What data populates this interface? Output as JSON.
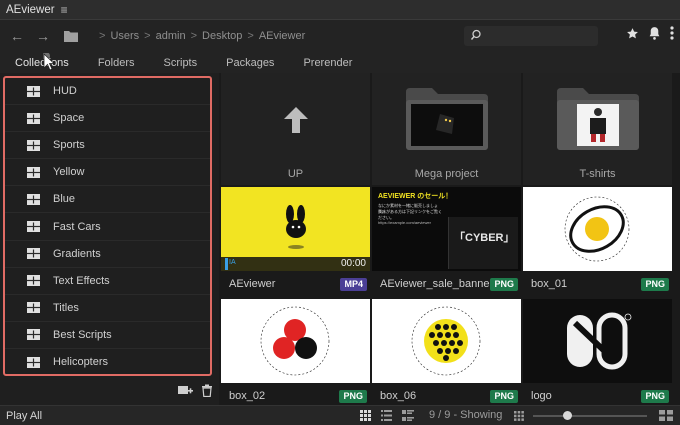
{
  "app": {
    "title": "AEviewer"
  },
  "breadcrumb": {
    "sep": ">",
    "items": [
      "Users",
      "admin",
      "Desktop",
      "AEviewer"
    ]
  },
  "search": {
    "placeholder": ""
  },
  "tabs": [
    "Collections",
    "Folders",
    "Scripts",
    "Packages",
    "Prerender"
  ],
  "active_tab": "Collections",
  "collections": [
    "HUD",
    "Space",
    "Sports",
    "Yellow",
    "Blue",
    "Fast Cars",
    "Gradients",
    "Text Effects",
    "Titles",
    "Best Scripts",
    "Helicopters"
  ],
  "grid": {
    "folders": [
      {
        "name": "UP",
        "icon": "up-arrow-icon"
      },
      {
        "name": "Mega project",
        "icon": "folder-icon"
      },
      {
        "name": "T-shirts",
        "icon": "folder-icon"
      }
    ],
    "files": [
      {
        "name": "AEviewer",
        "type": "MP4",
        "duration": "00:00",
        "marker": "IA"
      },
      {
        "name": "AEviewer_sale_banner",
        "type": "PNG"
      },
      {
        "name": "box_01",
        "type": "PNG"
      },
      {
        "name": "box_02",
        "type": "PNG"
      },
      {
        "name": "box_06",
        "type": "PNG"
      },
      {
        "name": "logo",
        "type": "PNG"
      }
    ]
  },
  "banner_text": {
    "headline": "AEVIEWER のセール！",
    "line1": "なにか素材を一緒に販売しましょう。",
    "line2": "興味がある方は下記リンクをご覧ください。",
    "url": "https://example.com/aeviewer",
    "big": "「CYBER」"
  },
  "bottom": {
    "play_all": "Play All",
    "count": "9 / 9 - Showing",
    "zoom": 0.3
  },
  "colors": {
    "highlight": "#e06b64",
    "png": "#1e7a4b",
    "mp4": "#4b3f96",
    "yellow": "#f2e422"
  }
}
